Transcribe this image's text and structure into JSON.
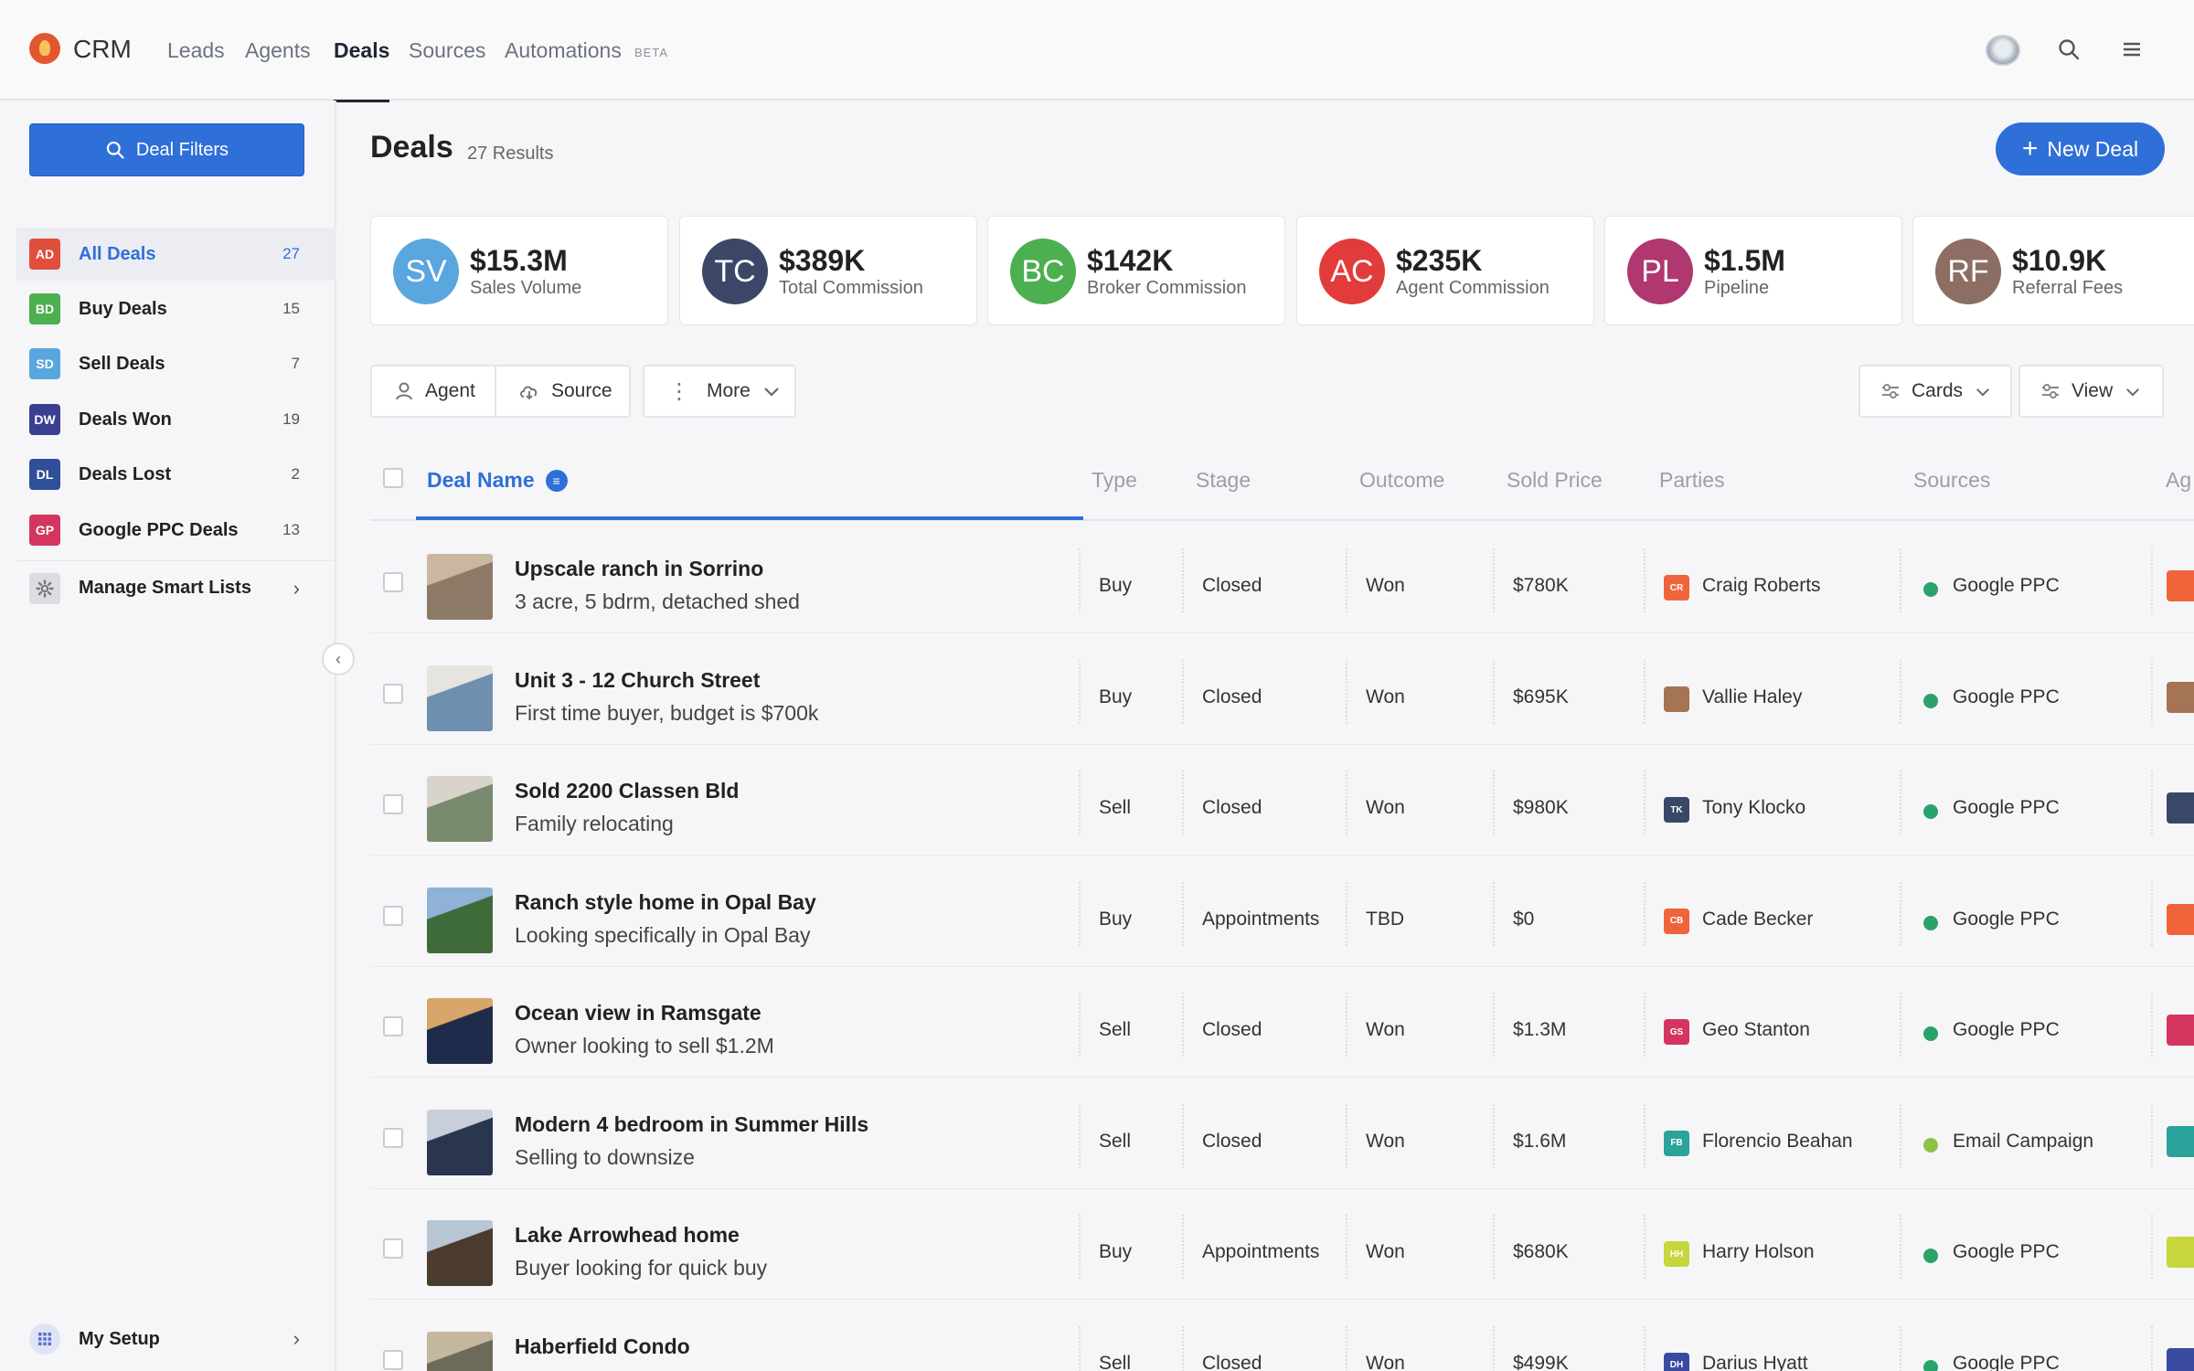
{
  "app": {
    "brand": "CRM"
  },
  "nav": [
    {
      "label": "Leads",
      "active": false
    },
    {
      "label": "Agents",
      "active": false
    },
    {
      "label": "Deals",
      "active": true
    },
    {
      "label": "Sources",
      "active": false
    },
    {
      "label": "Automations",
      "active": false
    }
  ],
  "nav_beta": "BETA",
  "sidebar": {
    "filter_button": "Deal Filters",
    "lists": [
      {
        "badge": "AD",
        "label": "All Deals",
        "count": "27",
        "color": "#e04e3c",
        "active": true
      },
      {
        "badge": "BD",
        "label": "Buy Deals",
        "count": "15",
        "color": "#4caf50",
        "active": false
      },
      {
        "badge": "SD",
        "label": "Sell Deals",
        "count": "7",
        "color": "#5aa6de",
        "active": false
      },
      {
        "badge": "DW",
        "label": "Deals Won",
        "count": "19",
        "color": "#3a3f8f",
        "active": false
      },
      {
        "badge": "DL",
        "label": "Deals Lost",
        "count": "2",
        "color": "#2f4f9a",
        "active": false
      },
      {
        "badge": "GP",
        "label": "Google PPC Deals",
        "count": "13",
        "color": "#d4355e",
        "active": false
      }
    ],
    "manage_label": "Manage Smart Lists",
    "setup_label": "My Setup"
  },
  "main": {
    "title": "Deals",
    "results": "27 Results",
    "new_button": "New Deal"
  },
  "stats": [
    {
      "initials": "SV",
      "value": "$15.3M",
      "label": "Sales Volume",
      "color": "#5aa6de"
    },
    {
      "initials": "TC",
      "value": "$389K",
      "label": "Total Commission",
      "color": "#3c4767"
    },
    {
      "initials": "BC",
      "value": "$142K",
      "label": "Broker Commission",
      "color": "#4caf50"
    },
    {
      "initials": "AC",
      "value": "$235K",
      "label": "Agent Commission",
      "color": "#e23b3b"
    },
    {
      "initials": "PL",
      "value": "$1.5M",
      "label": "Pipeline",
      "color": "#b0376f"
    },
    {
      "initials": "RF",
      "value": "$10.9K",
      "label": "Referral Fees",
      "color": "#8d6e63"
    }
  ],
  "filters": {
    "agent": "Agent",
    "source": "Source",
    "more": "More",
    "cards": "Cards",
    "view": "View"
  },
  "table": {
    "columns": {
      "name": "Deal Name",
      "type": "Type",
      "stage": "Stage",
      "outcome": "Outcome",
      "price": "Sold Price",
      "parties": "Parties",
      "sources": "Sources",
      "agent": "Ag"
    },
    "rows": [
      {
        "name": "Upscale ranch in Sorrino",
        "sub": "3 acre, 5 bdrm, detached shed",
        "type": "Buy",
        "stage": "Closed",
        "outcome": "Won",
        "price": "$780K",
        "party": "Craig Roberts",
        "party_initials": "CR",
        "party_color": "#f0643c",
        "source": "Google PPC",
        "source_color": "#2aa36b",
        "thumb_a": "#8d7a66",
        "thumb_b": "#c9b7a0"
      },
      {
        "name": "Unit 3 - 12 Church Street",
        "sub": "First time buyer, budget is $700k",
        "type": "Buy",
        "stage": "Closed",
        "outcome": "Won",
        "price": "$695K",
        "party": "Vallie Haley",
        "party_initials": "",
        "party_color": "#a47455",
        "source": "Google PPC",
        "source_color": "#2aa36b",
        "thumb_a": "#6f8fb0",
        "thumb_b": "#e6e4df"
      },
      {
        "name": "Sold 2200 Classen Bld",
        "sub": "Family relocating",
        "type": "Sell",
        "stage": "Closed",
        "outcome": "Won",
        "price": "$980K",
        "party": "Tony Klocko",
        "party_initials": "TK",
        "party_color": "#3a4868",
        "source": "Google PPC",
        "source_color": "#2aa36b",
        "thumb_a": "#7a8a6e",
        "thumb_b": "#d8d4cc"
      },
      {
        "name": "Ranch style home in Opal Bay",
        "sub": "Looking specifically in Opal Bay",
        "type": "Buy",
        "stage": "Appointments",
        "outcome": "TBD",
        "price": "$0",
        "party": "Cade Becker",
        "party_initials": "CB",
        "party_color": "#f0643c",
        "source": "Google PPC",
        "source_color": "#2aa36b",
        "thumb_a": "#3f6b3a",
        "thumb_b": "#8fb2d6"
      },
      {
        "name": "Ocean view in Ramsgate",
        "sub": "Owner looking to sell $1.2M",
        "type": "Sell",
        "stage": "Closed",
        "outcome": "Won",
        "price": "$1.3M",
        "party": "Geo Stanton",
        "party_initials": "GS",
        "party_color": "#d4355e",
        "source": "Google PPC",
        "source_color": "#2aa36b",
        "thumb_a": "#1f2b4a",
        "thumb_b": "#d7a66a"
      },
      {
        "name": "Modern 4 bedroom in Summer Hills",
        "sub": "Selling to downsize",
        "type": "Sell",
        "stage": "Closed",
        "outcome": "Won",
        "price": "$1.6M",
        "party": "Florencio Beahan",
        "party_initials": "FB",
        "party_color": "#2aa39a",
        "source": "Email Campaign",
        "source_color": "#8bc34a",
        "thumb_a": "#2a3550",
        "thumb_b": "#c8cfd8"
      },
      {
        "name": "Lake Arrowhead home",
        "sub": "Buyer looking for quick buy",
        "type": "Buy",
        "stage": "Appointments",
        "outcome": "Won",
        "price": "$680K",
        "party": "Harry Holson",
        "party_initials": "HH",
        "party_color": "#c6d63c",
        "source": "Google PPC",
        "source_color": "#2aa36b",
        "thumb_a": "#4a3b2e",
        "thumb_b": "#b8c6d4"
      },
      {
        "name": "Haberfield Condo",
        "sub": "",
        "type": "Sell",
        "stage": "Closed",
        "outcome": "Won",
        "price": "$499K",
        "party": "Darius Hyatt",
        "party_initials": "DH",
        "party_color": "#3a4aa0",
        "source": "Google PPC",
        "source_color": "#2aa36b",
        "thumb_a": "#6e6a5a",
        "thumb_b": "#c4b89e"
      }
    ]
  },
  "icons": {
    "logo": "flame-logo-icon",
    "search": "search-icon",
    "menu": "hamburger-menu-icon",
    "agent_filter": "person-icon",
    "source_filter": "cloud-icon",
    "cards": "sliders-icon",
    "view": "sliders-icon"
  }
}
